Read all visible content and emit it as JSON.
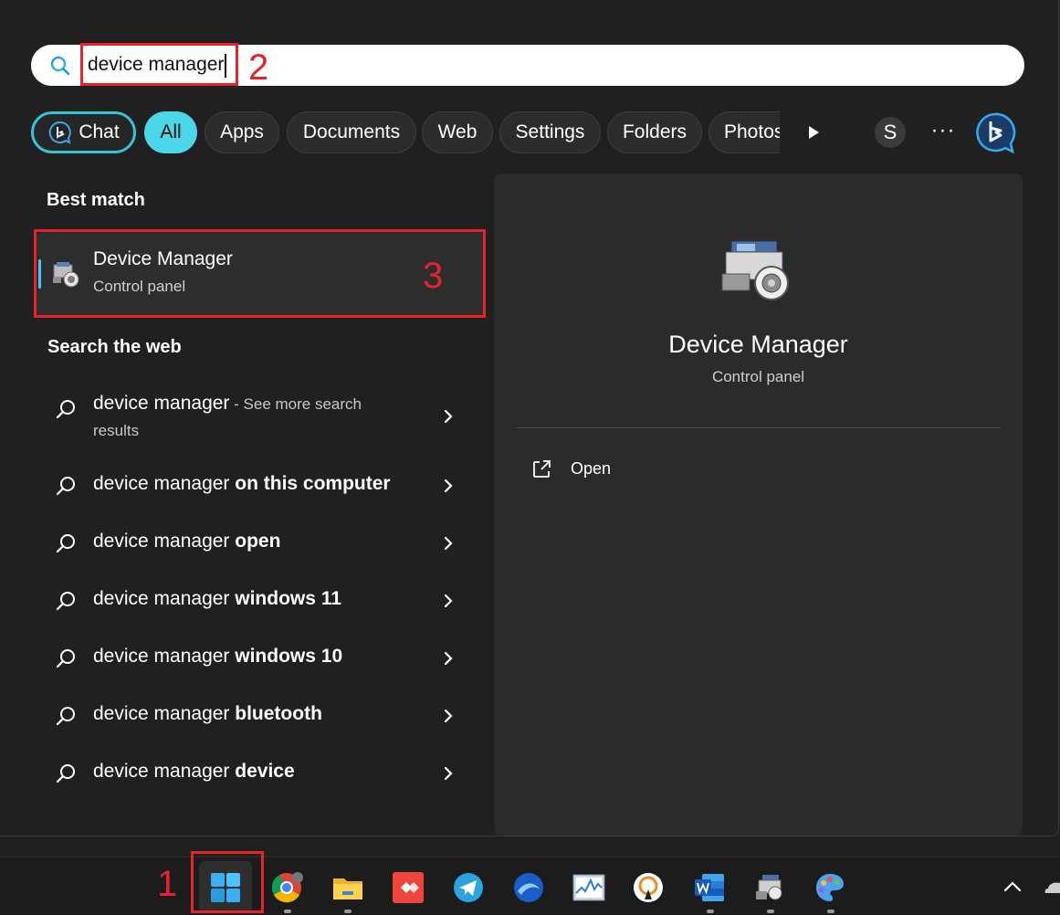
{
  "search": {
    "value": "device manager",
    "annotation": "2"
  },
  "filters": {
    "chat": "Chat",
    "all": "All",
    "apps": "Apps",
    "documents": "Documents",
    "web": "Web",
    "settings": "Settings",
    "folders": "Folders",
    "photos": "Photos",
    "avatar_initial": "S",
    "more": "···"
  },
  "best_match": {
    "heading": "Best match",
    "title": "Device Manager",
    "subtitle": "Control panel",
    "annotation": "3"
  },
  "web": {
    "heading": "Search the web",
    "rows": [
      {
        "query": "device manager",
        "suffix": " - See more search",
        "suffix2": "results"
      },
      {
        "query": "device manager",
        "bold": "on this computer"
      },
      {
        "query": "device manager",
        "bold": "open"
      },
      {
        "query": "device manager",
        "bold": "windows 11"
      },
      {
        "query": "device manager",
        "bold": "windows 10"
      },
      {
        "query": "device manager",
        "bold": "bluetooth"
      },
      {
        "query": "device manager",
        "bold": "device"
      }
    ]
  },
  "preview": {
    "title": "Device Manager",
    "subtitle": "Control panel",
    "open_label": "Open"
  },
  "taskbar": {
    "annotation": "1",
    "icons": [
      "windows-start-icon",
      "chrome-icon",
      "file-explorer-icon",
      "anydesk-icon",
      "telegram-icon",
      "browser-icon",
      "resource-monitor-icon",
      "vpn-icon",
      "word-icon",
      "device-manager-icon",
      "paint-icon"
    ]
  },
  "colors": {
    "accent": "#4cd6e9",
    "annotation": "#e8222b",
    "background": "#202020"
  }
}
